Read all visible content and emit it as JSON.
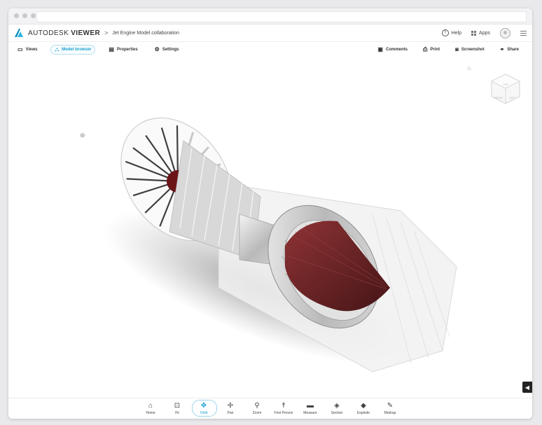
{
  "app": {
    "brand": "AUTODESK",
    "product": "VIEWER",
    "breadcrumb_sep": ">",
    "file_name": "Jet Engine Model.collaboration"
  },
  "appbar": {
    "help": "Help",
    "apps": "Apps"
  },
  "toolbar_left": [
    {
      "label": "Views",
      "icon": "monitor-icon"
    },
    {
      "label": "Model browser",
      "icon": "hierarchy-icon",
      "active": true
    },
    {
      "label": "Properties",
      "icon": "document-icon"
    },
    {
      "label": "Settings",
      "icon": "gear-icon"
    }
  ],
  "toolbar_right": [
    {
      "label": "Comments",
      "icon": "comment-icon"
    },
    {
      "label": "Print",
      "icon": "printer-icon"
    },
    {
      "label": "Screenshot",
      "icon": "camera-icon"
    },
    {
      "label": "Share",
      "icon": "link-icon"
    }
  ],
  "viewcube": {
    "top": "TOP",
    "front": "FRONT",
    "left": "LEFT"
  },
  "bottom_tools": [
    {
      "label": "Home",
      "icon": "home-icon",
      "glyph": "⌂"
    },
    {
      "label": "Fit",
      "icon": "fit-icon",
      "glyph": "⊡"
    },
    {
      "label": "Orbit",
      "icon": "orbit-icon",
      "glyph": "✥",
      "active": true
    },
    {
      "label": "Pan",
      "icon": "pan-icon",
      "glyph": "✢"
    },
    {
      "label": "Zoom",
      "icon": "zoom-icon",
      "glyph": "⚲"
    },
    {
      "label": "First Person",
      "icon": "person-icon",
      "glyph": "☨"
    },
    {
      "label": "Measure",
      "icon": "ruler-icon",
      "glyph": "▬"
    },
    {
      "label": "Section",
      "icon": "section-icon",
      "glyph": "◈"
    },
    {
      "label": "Explode",
      "icon": "explode-icon",
      "glyph": "◆"
    },
    {
      "label": "Markup",
      "icon": "pen-icon",
      "glyph": "✎"
    }
  ],
  "colors": {
    "accent": "#1aa0d0",
    "cone": "#6b1418"
  }
}
